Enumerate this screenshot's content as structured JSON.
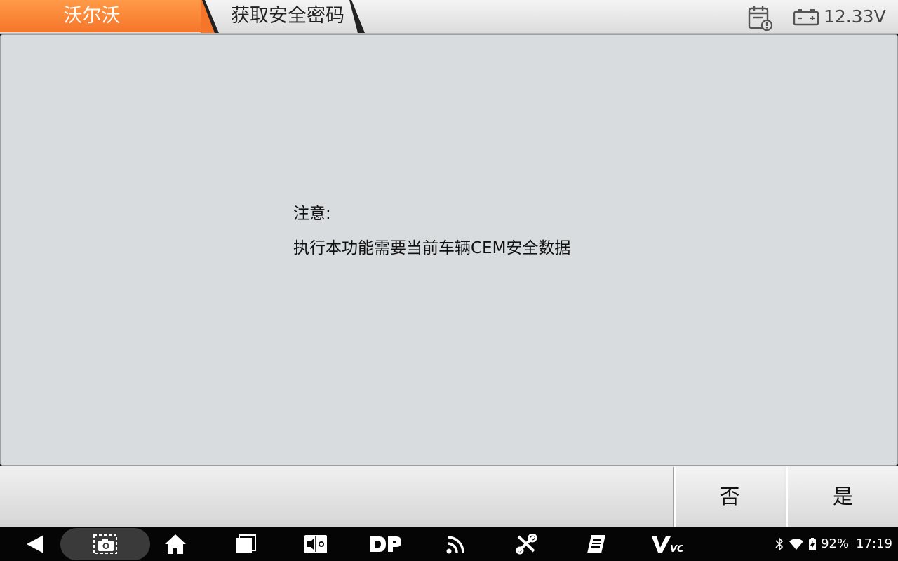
{
  "header": {
    "brand": "沃尔沃",
    "page_title": "获取安全密码",
    "voltage": "12.33V",
    "icons": [
      "calendar-alert-icon",
      "battery-icon"
    ],
    "colors": {
      "brand_bg": "#f5762a",
      "header_bg": "#e6e6e6"
    }
  },
  "dialog": {
    "title": "注意:",
    "message": "执行本功能需要当前车辆CEM安全数据"
  },
  "actions": {
    "no_label": "否",
    "yes_label": "是"
  },
  "navbar": {
    "buttons": [
      "back-icon",
      "screenshot-icon",
      "home-icon",
      "recent-apps-icon",
      "volume-brightness-icon",
      "dp-icon",
      "signal-feed-icon",
      "tools-icon",
      "report-icon",
      "vci-icon"
    ],
    "vci_label": "VCI"
  },
  "status": {
    "battery": "92%",
    "time": "17:19",
    "icons": [
      "bluetooth-icon",
      "wifi-icon",
      "battery-charging-icon"
    ]
  }
}
